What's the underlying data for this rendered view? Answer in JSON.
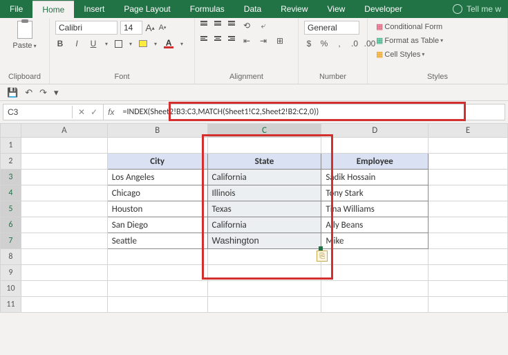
{
  "tabs": [
    "File",
    "Home",
    "Insert",
    "Page Layout",
    "Formulas",
    "Data",
    "Review",
    "View",
    "Developer"
  ],
  "activeTab": "Home",
  "tellMe": "Tell me w",
  "ribbon": {
    "font": {
      "name": "Calibri",
      "size": "14"
    },
    "numberFormat": "General",
    "groups": {
      "clipboard": "Clipboard",
      "font": "Font",
      "alignment": "Alignment",
      "number": "Number",
      "styles": "Styles"
    },
    "stylesItems": [
      "Conditional Form",
      "Format as Table",
      "Cell Styles"
    ]
  },
  "nameBox": "C3",
  "formula": "=INDEX(Sheet2!B3:C3,MATCH(Sheet1!C2,Sheet2!B2:C2,0))",
  "columns": [
    "A",
    "B",
    "C",
    "D",
    "E"
  ],
  "rows": [
    "1",
    "2",
    "3",
    "4",
    "5",
    "6",
    "7",
    "8",
    "9",
    "10",
    "11"
  ],
  "headers": {
    "B2": "City",
    "C2": "State",
    "D2": "Employee"
  },
  "data": {
    "city": [
      "Los Angeles",
      "Chicago",
      "Houston",
      "San Diego",
      "Seattle"
    ],
    "state": [
      "California",
      "Illinois",
      "Texas",
      "California",
      "Washington"
    ],
    "employee": [
      "Sadik Hossain",
      "Tony Stark",
      "Tina Williams",
      "Ally Beans",
      "Mike"
    ]
  },
  "icons": {
    "paste": "Paste",
    "bold": "B",
    "italic": "I",
    "underline": "U",
    "increaseFont": "A",
    "decreaseFont": "A",
    "fontColor": "A",
    "wrap": "Wrap",
    "merge": "Merge"
  }
}
